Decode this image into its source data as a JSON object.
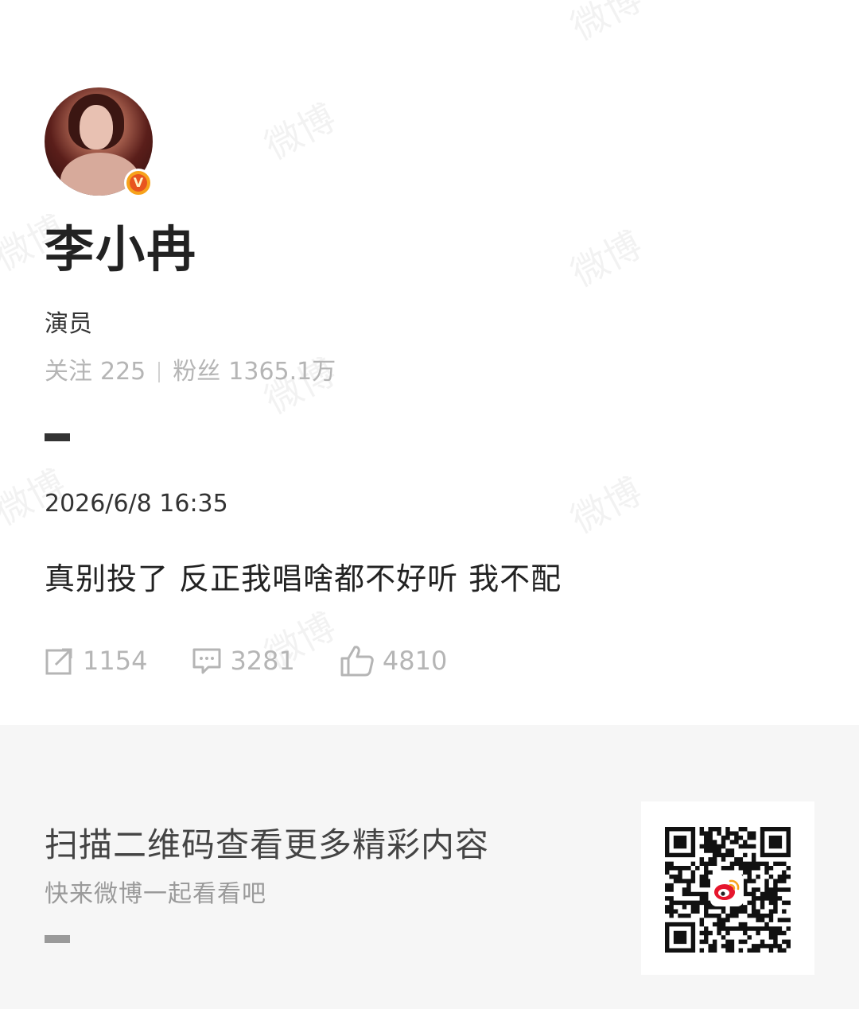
{
  "watermark_text": "微博",
  "profile": {
    "name": "李小冉",
    "role": "演员",
    "following_label": "关注",
    "following_count": "225",
    "followers_label": "粉丝",
    "followers_count": "1365.1万",
    "verified_mark": "V"
  },
  "post": {
    "datetime": "2026/6/8 16:35",
    "text": "真别投了 反正我唱啥都不好听 我不配",
    "reposts": "1154",
    "comments": "3281",
    "likes": "4810"
  },
  "footer": {
    "title": "扫描二维码查看更多精彩内容",
    "subtitle": "快来微博一起看看吧"
  },
  "colors": {
    "verified_badge": "#f7a21b",
    "text_primary": "#222222",
    "text_muted": "#b5b5b5",
    "footer_bg": "#f6f6f6"
  },
  "icons": {
    "repost": "repost-icon",
    "comment": "comment-icon",
    "like": "thumbs-up-icon",
    "qr": "qr-code",
    "logo": "weibo-logo-icon"
  }
}
